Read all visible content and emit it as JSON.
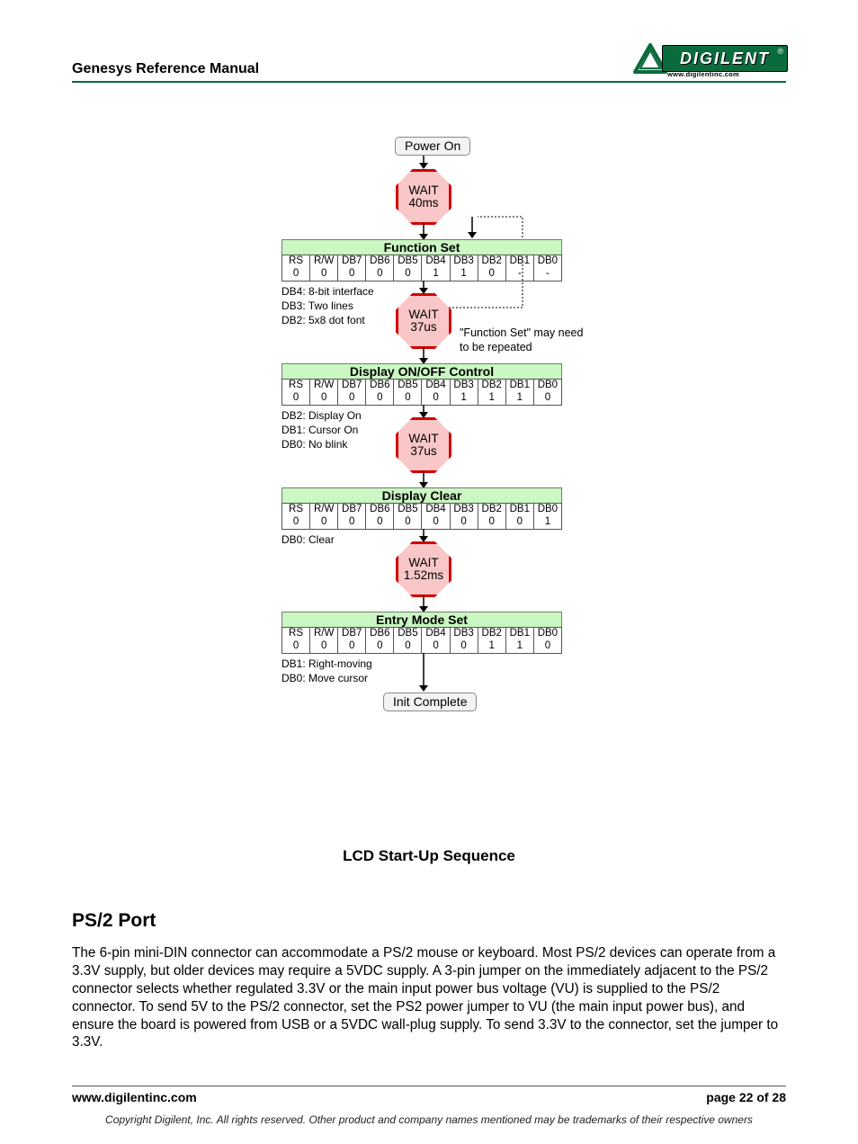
{
  "header": {
    "title": "Genesys Reference Manual",
    "logo_text": "DIGILENT",
    "logo_url": "www.digilentinc.com"
  },
  "diagram": {
    "start": "Power On",
    "end": "Init Complete",
    "waits": [
      "WAIT",
      "40ms",
      "WAIT",
      "37us",
      "WAIT",
      "37us",
      "WAIT",
      "1.52ms"
    ],
    "side_note": "\"Function Set\" may need to be repeated",
    "stages": [
      {
        "title": "Function Set",
        "headers": [
          "RS",
          "R/W",
          "DB7",
          "DB6",
          "DB5",
          "DB4",
          "DB3",
          "DB2",
          "DB1",
          "DB0"
        ],
        "values": [
          "0",
          "0",
          "0",
          "0",
          "0",
          "1",
          "1",
          "0",
          "-",
          "-"
        ],
        "notes": [
          "DB4: 8-bit interface",
          "DB3: Two lines",
          "DB2: 5x8 dot font"
        ]
      },
      {
        "title": "Display ON/OFF Control",
        "headers": [
          "RS",
          "R/W",
          "DB7",
          "DB6",
          "DB5",
          "DB4",
          "DB3",
          "DB2",
          "DB1",
          "DB0"
        ],
        "values": [
          "0",
          "0",
          "0",
          "0",
          "0",
          "0",
          "1",
          "1",
          "1",
          "0"
        ],
        "notes": [
          "DB2: Display On",
          "DB1: Cursor On",
          "DB0: No blink"
        ]
      },
      {
        "title": "Display Clear",
        "headers": [
          "RS",
          "R/W",
          "DB7",
          "DB6",
          "DB5",
          "DB4",
          "DB3",
          "DB2",
          "DB1",
          "DB0"
        ],
        "values": [
          "0",
          "0",
          "0",
          "0",
          "0",
          "0",
          "0",
          "0",
          "0",
          "1"
        ],
        "notes": [
          "DB0: Clear"
        ]
      },
      {
        "title": "Entry Mode Set",
        "headers": [
          "RS",
          "R/W",
          "DB7",
          "DB6",
          "DB5",
          "DB4",
          "DB3",
          "DB2",
          "DB1",
          "DB0"
        ],
        "values": [
          "0",
          "0",
          "0",
          "0",
          "0",
          "0",
          "0",
          "1",
          "1",
          "0"
        ],
        "notes": [
          "DB1: Right-moving",
          "DB0: Move cursor"
        ]
      }
    ],
    "caption": "LCD Start-Up Sequence"
  },
  "section": {
    "heading": "PS/2 Port",
    "paragraph": "The 6-pin mini-DIN connector can accommodate a PS/2 mouse or keyboard. Most PS/2 devices can operate from a 3.3V supply, but older devices may require a 5VDC supply. A 3-pin jumper on the immediately adjacent to the PS/2 connector selects whether regulated 3.3V or the main input power bus voltage (VU) is supplied to the PS/2 connector. To send 5V to the PS/2 connector, set the PS2 power jumper to VU (the main input power bus), and ensure the board is powered from USB or a 5VDC wall-plug supply. To send 3.3V to the connector, set the jumper to 3.3V."
  },
  "footer": {
    "url": "www.digilentinc.com",
    "page": "page 22 of 28",
    "copyright": "Copyright Digilent, Inc. All rights reserved. Other product and company names mentioned may be trademarks of their respective owners"
  }
}
